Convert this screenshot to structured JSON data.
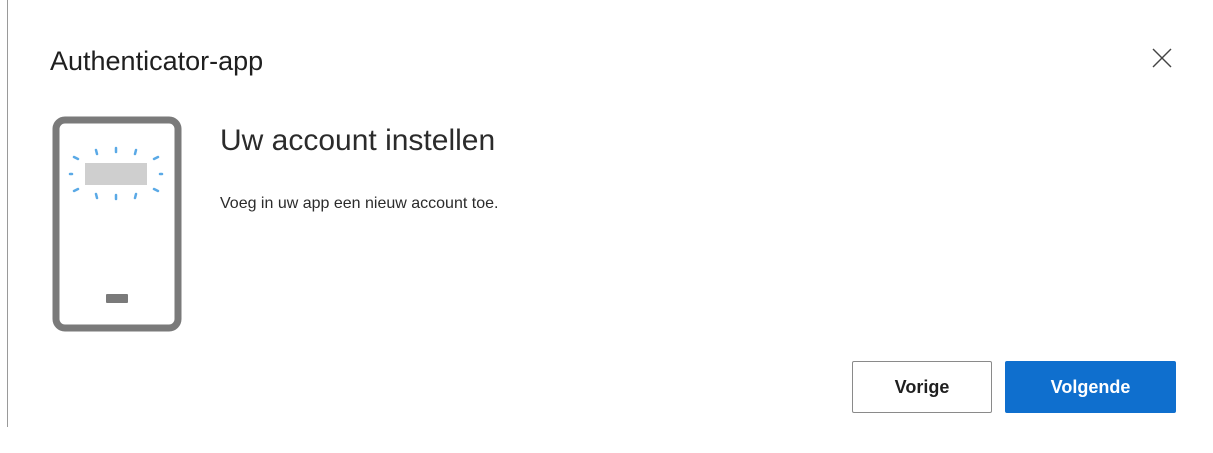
{
  "dialog": {
    "title": "Authenticator-app",
    "close_icon": "close-icon"
  },
  "step": {
    "illustration_icon": "phone-notification-icon",
    "heading": "Uw account instellen",
    "description": "Voeg in uw app een nieuw account toe."
  },
  "actions": {
    "back_label": "Vorige",
    "next_label": "Volgende"
  },
  "colors": {
    "primary": "#0f6fce",
    "phone_frame": "#7a7a7a",
    "phone_rays": "#5aa9e6"
  }
}
